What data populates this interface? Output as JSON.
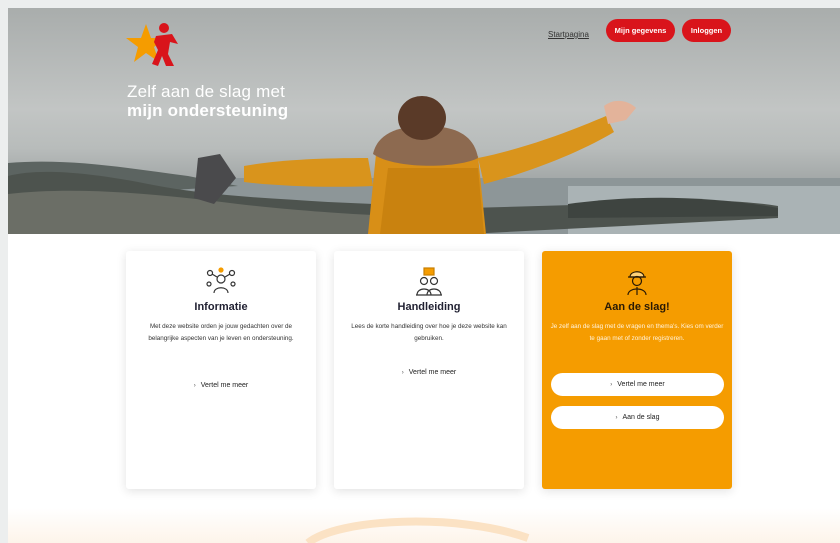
{
  "header": {
    "tagline_line1": "Zelf aan de slag met",
    "tagline_line2": "mijn ondersteuning",
    "nav_link": "Startpagina",
    "register_label": "Mijn gegevens",
    "login_label": "Inloggen"
  },
  "cards": [
    {
      "title": "Informatie",
      "text": "Met deze website orden je jouw gedachten over de belangrijke aspecten van je leven en ondersteuning.",
      "link": "Vertel me meer",
      "icon": "people-network-icon"
    },
    {
      "title": "Handleiding",
      "text": "Lees de korte handleiding over hoe je deze website kan gebruiken.",
      "link": "Vertel me meer",
      "icon": "users-book-icon"
    },
    {
      "title": "Aan de slag!",
      "text": "Je zelf aan de slag met de vragen en thema's. Kies om verder te gaan met of zonder registreren.",
      "button1": "Vertel me meer",
      "button2": "Aan de slag",
      "icon": "worker-icon"
    }
  ],
  "colors": {
    "accent_red": "#d9141b",
    "accent_orange": "#f59c00"
  }
}
